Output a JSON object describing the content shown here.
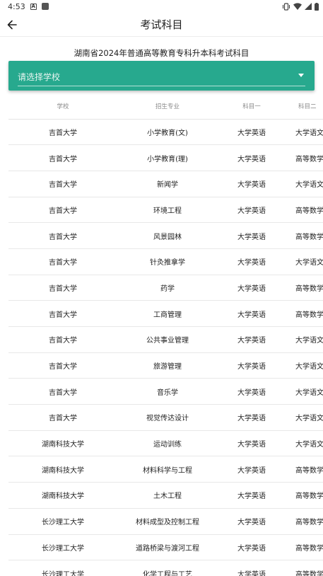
{
  "status_bar": {
    "time": "4:53",
    "icons": [
      "a-icon",
      "square-icon",
      "vibrate-icon",
      "wifi-icon",
      "signal-icon",
      "battery-icon"
    ]
  },
  "app_bar": {
    "title": "考试科目",
    "back_icon": "arrow-left-icon"
  },
  "heading": "湖南省2024年普通高等教育专科升本科考试科目",
  "school_select": {
    "placeholder": "请选择学校",
    "bg_color": "#27a98e",
    "arrow_icon": "dropdown-arrow-icon"
  },
  "table": {
    "headers": [
      "学校",
      "招生专业",
      "科目一",
      "科目二"
    ],
    "rows": [
      [
        "吉首大学",
        "小学教育(文)",
        "大学英语",
        "大学语文"
      ],
      [
        "吉首大学",
        "小学教育(理)",
        "大学英语",
        "高等数学"
      ],
      [
        "吉首大学",
        "新闻学",
        "大学英语",
        "大学语文"
      ],
      [
        "吉首大学",
        "环境工程",
        "大学英语",
        "高等数学"
      ],
      [
        "吉首大学",
        "风景园林",
        "大学英语",
        "高等数学"
      ],
      [
        "吉首大学",
        "针灸推拿学",
        "大学英语",
        "大学语文"
      ],
      [
        "吉首大学",
        "药学",
        "大学英语",
        "高等数学"
      ],
      [
        "吉首大学",
        "工商管理",
        "大学英语",
        "高等数学"
      ],
      [
        "吉首大学",
        "公共事业管理",
        "大学英语",
        "大学语文"
      ],
      [
        "吉首大学",
        "旅游管理",
        "大学英语",
        "大学语文"
      ],
      [
        "吉首大学",
        "音乐学",
        "大学英语",
        "大学语文"
      ],
      [
        "吉首大学",
        "视觉传达设计",
        "大学英语",
        "大学语文"
      ],
      [
        "湖南科技大学",
        "运动训练",
        "大学英语",
        "大学语文"
      ],
      [
        "湖南科技大学",
        "材料科学与工程",
        "大学英语",
        "高等数学"
      ],
      [
        "湖南科技大学",
        "土木工程",
        "大学英语",
        "高等数学"
      ],
      [
        "长沙理工大学",
        "材料成型及控制工程",
        "大学英语",
        "高等数学"
      ],
      [
        "长沙理工大学",
        "道路桥梁与渡河工程",
        "大学英语",
        "高等数学"
      ],
      [
        "长沙理工大学",
        "化学工程与工艺",
        "大学英语",
        "高等数学"
      ]
    ]
  }
}
